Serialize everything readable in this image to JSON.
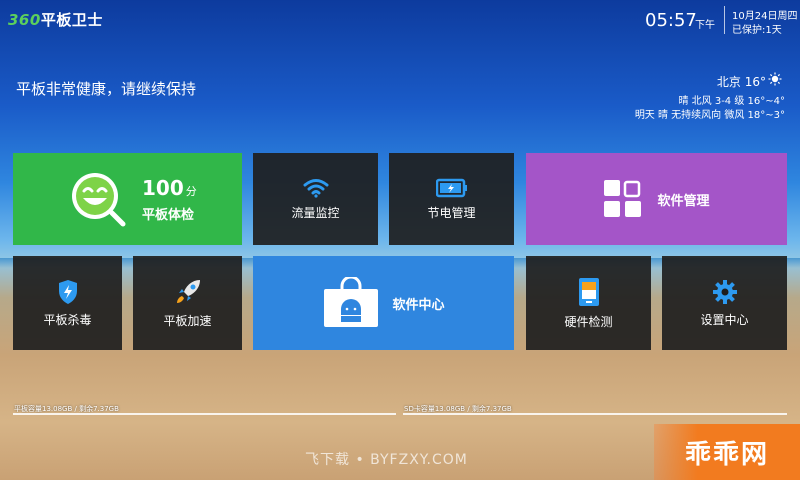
{
  "header": {
    "logo_num": "360",
    "logo_text": "平板卫士",
    "time": "05:57",
    "ampm": "下午",
    "date": "10月24日周四",
    "protected": "已保护:1天"
  },
  "status_message": "平板非常健康，请继续保持",
  "weather": {
    "city_temp": "北京 16°",
    "today": "晴 北风 3-4 级 16°~4°",
    "tomorrow": "明天 晴 无持续风向 微风 18°~3°"
  },
  "tiles": {
    "checkup": {
      "score": "100",
      "unit": "分",
      "label": "平板体检"
    },
    "flow": {
      "label": "流量监控",
      "icon": "wifi-icon"
    },
    "power": {
      "label": "节电管理",
      "icon": "battery-icon"
    },
    "apps": {
      "label": "软件管理",
      "icon": "grid-icon"
    },
    "virus": {
      "label": "平板杀毒",
      "icon": "shield-icon"
    },
    "boost": {
      "label": "平板加速",
      "icon": "rocket-icon"
    },
    "store": {
      "label": "软件中心",
      "icon": "android-bag-icon"
    },
    "hardware": {
      "label": "硬件检测",
      "icon": "tablet-icon"
    },
    "settings": {
      "label": "设置中心",
      "icon": "gear-icon"
    }
  },
  "storage": {
    "internal": "平板容量13.08GB / 剩余7.37GB",
    "sd": "SD卡容量13.08GB / 剩余7.37GB"
  },
  "watermark": "飞下载 • BYFZXY.COM",
  "badge": "乖乖网",
  "colors": {
    "checkup_tile": "#31b749",
    "apps_tile": "#a455c8",
    "store_tile": "#2f86df",
    "dark_tile": "#1e1e1e",
    "badge": "#f27b1f"
  }
}
